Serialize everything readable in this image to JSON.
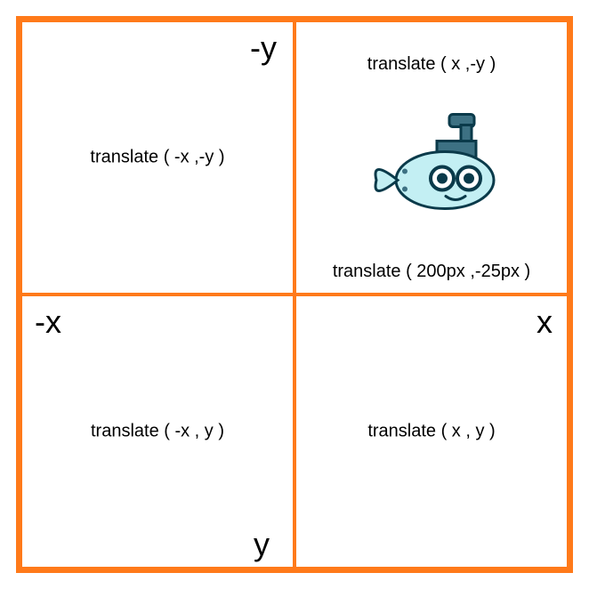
{
  "axes": {
    "neg_y": "-y",
    "neg_x": "-x",
    "pos_x": "x",
    "pos_y": "y"
  },
  "quadrants": {
    "top_left": {
      "func": "translate ( -x ,-y )"
    },
    "top_right": {
      "func": "translate ( x ,-y )",
      "example": "translate ( 200px ,-25px )"
    },
    "bottom_left": {
      "func": "translate ( -x , y )"
    },
    "bottom_right": {
      "func": "translate ( x , y )"
    }
  },
  "icon": {
    "name": "submarine-icon"
  }
}
